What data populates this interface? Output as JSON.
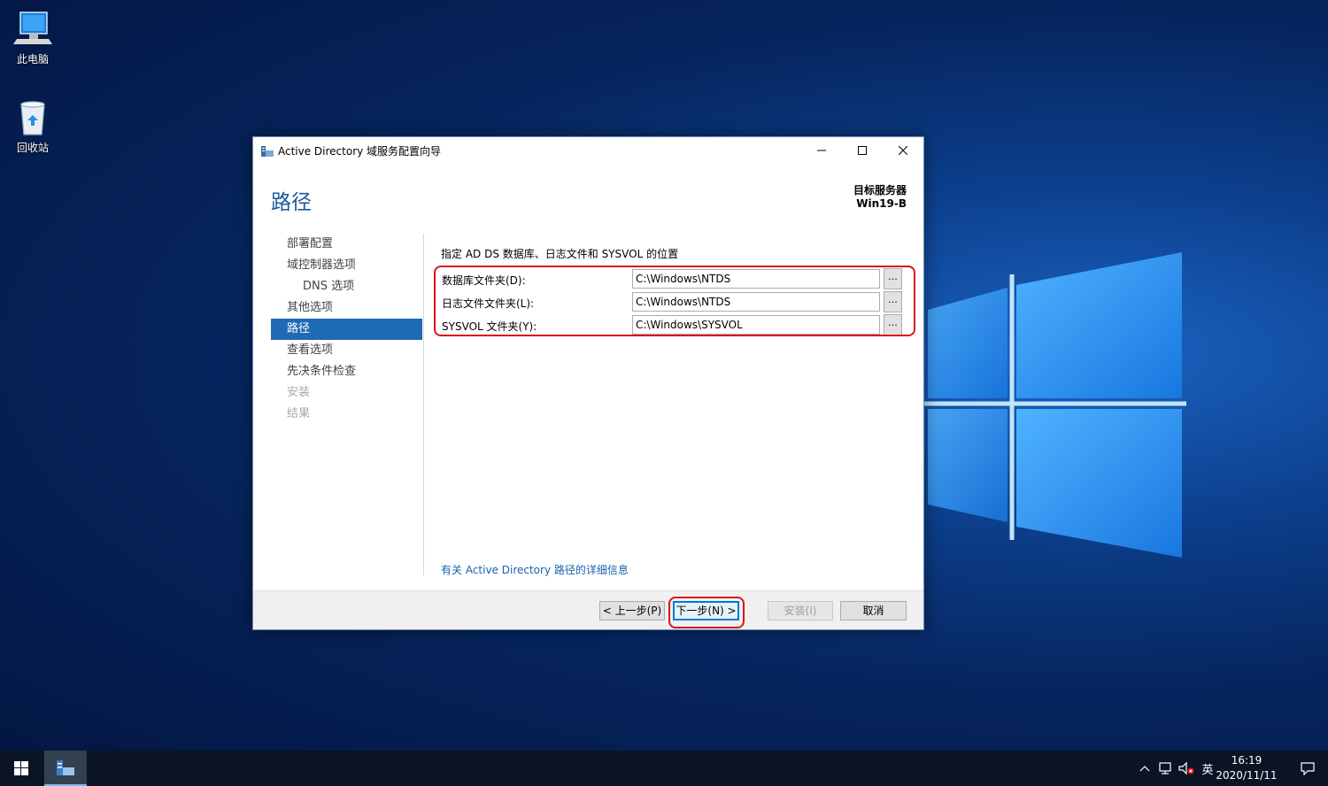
{
  "desktop": {
    "icons": [
      {
        "label": "此电脑",
        "icon": "computer-icon"
      },
      {
        "label": "回收站",
        "icon": "recycle-bin-icon"
      }
    ]
  },
  "dialog": {
    "title": "Active Directory 域服务配置向导",
    "page_title": "路径",
    "target_label": "目标服务器",
    "target_name": "Win19-B",
    "nav": [
      {
        "label": "部署配置",
        "state": "normal"
      },
      {
        "label": "域控制器选项",
        "state": "normal"
      },
      {
        "label": "DNS 选项",
        "state": "sub"
      },
      {
        "label": "其他选项",
        "state": "normal"
      },
      {
        "label": "路径",
        "state": "active"
      },
      {
        "label": "查看选项",
        "state": "normal"
      },
      {
        "label": "先决条件检查",
        "state": "normal"
      },
      {
        "label": "安装",
        "state": "disabled"
      },
      {
        "label": "结果",
        "state": "disabled"
      }
    ],
    "description": "指定 AD DS 数据库、日志文件和 SYSVOL 的位置",
    "fields": [
      {
        "label": "数据库文件夹(D):",
        "value": "C:\\Windows\\NTDS",
        "browse": "..."
      },
      {
        "label": "日志文件文件夹(L):",
        "value": "C:\\Windows\\NTDS",
        "browse": "..."
      },
      {
        "label": "SYSVOL 文件夹(Y):",
        "value": "C:\\Windows\\SYSVOL",
        "browse": "..."
      }
    ],
    "more_link": "有关 Active Directory 路径的详细信息",
    "buttons": {
      "prev": "< 上一步(P)",
      "next": "下一步(N) >",
      "install": "安装(I)",
      "cancel": "取消"
    },
    "highlight_color": "#d9141b"
  },
  "taskbar": {
    "time": "16:19",
    "date": "2020/11/11",
    "ime": "英",
    "tray_icons": [
      "chevron-up-icon",
      "network-icon",
      "volume-muted-icon"
    ]
  },
  "colors": {
    "accent": "#1f6ab5",
    "title_blue": "#1c5a9b",
    "link": "#1562ad"
  }
}
